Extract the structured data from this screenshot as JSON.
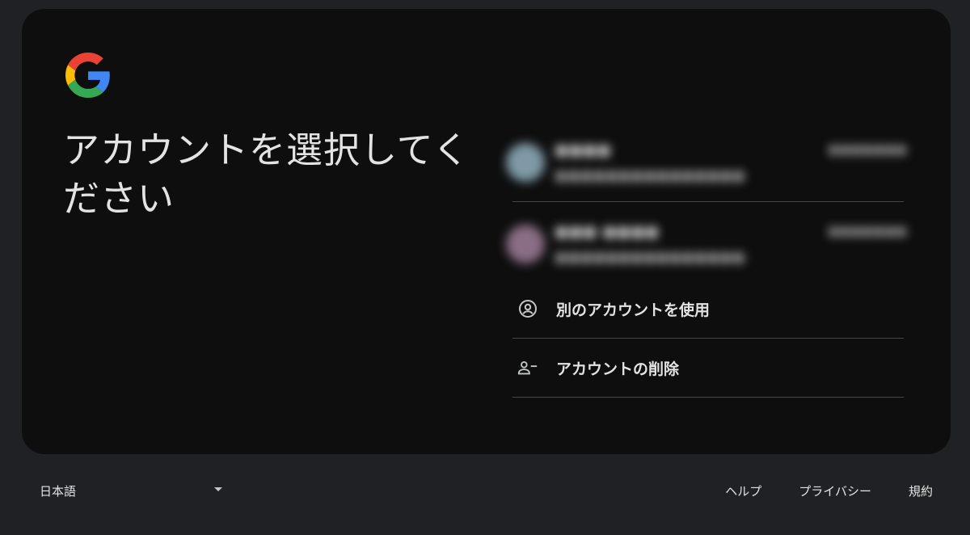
{
  "headline": "アカウントを選択してください",
  "accounts": [
    {
      "name": "●●●●",
      "email": "●●●●●●●●●●●●●●●",
      "status": "●●●●●●●",
      "avatar_color": "#7f9aa6"
    },
    {
      "name": "●●● ●●●●",
      "email": "●●●●●●●●●●●●●●●",
      "status": "●●●●●●●",
      "avatar_color": "#8a6e86"
    }
  ],
  "actions": {
    "use_another": "別のアカウントを使用",
    "remove_account": "アカウントの削除"
  },
  "footer": {
    "language": "日本語",
    "help": "ヘルプ",
    "privacy": "プライバシー",
    "terms": "規約"
  },
  "icons": {
    "logo": "google-g-logo",
    "use_another": "account-circle-icon",
    "remove_account": "person-remove-icon",
    "language_caret": "caret-down-icon"
  }
}
